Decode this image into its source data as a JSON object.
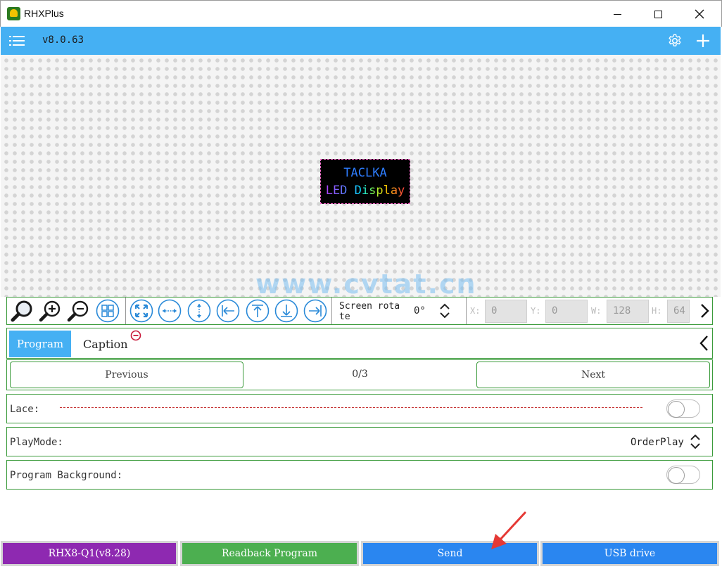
{
  "window": {
    "title": "RHXPlus"
  },
  "header": {
    "version": "v8.0.63"
  },
  "led_preview": {
    "line1": "TACLKA",
    "line2": "LED Display"
  },
  "watermark": "www.cvtat.cn",
  "toolbar": {
    "screen_rotate_label": "Screen rota te",
    "screen_rotate_value": "0°",
    "x_label": "X:",
    "x_value": "0",
    "y_label": "Y:",
    "y_value": "0",
    "w_label": "W:",
    "w_value": "128",
    "h_label": "H:",
    "h_value": "64"
  },
  "tabs": {
    "program": "Program",
    "caption": "Caption"
  },
  "pager": {
    "previous": "Previous",
    "count": "0/3",
    "next": "Next"
  },
  "rows": {
    "lace_label": "Lace:",
    "playmode_label": "PlayMode:",
    "playmode_value": "OrderPlay",
    "background_label": "Program Background:"
  },
  "bottom": {
    "device": "RHX8-Q1(v8.28)",
    "readback": "Readback Program",
    "send": "Send",
    "usb": "USB drive"
  },
  "colors": {
    "header": "#45b0f3",
    "border_green": "#3b9b3b",
    "device_button": "#8e29b1",
    "readback_button": "#4caf50",
    "send_button": "#2a86f0",
    "usb_button": "#2a86f0"
  }
}
